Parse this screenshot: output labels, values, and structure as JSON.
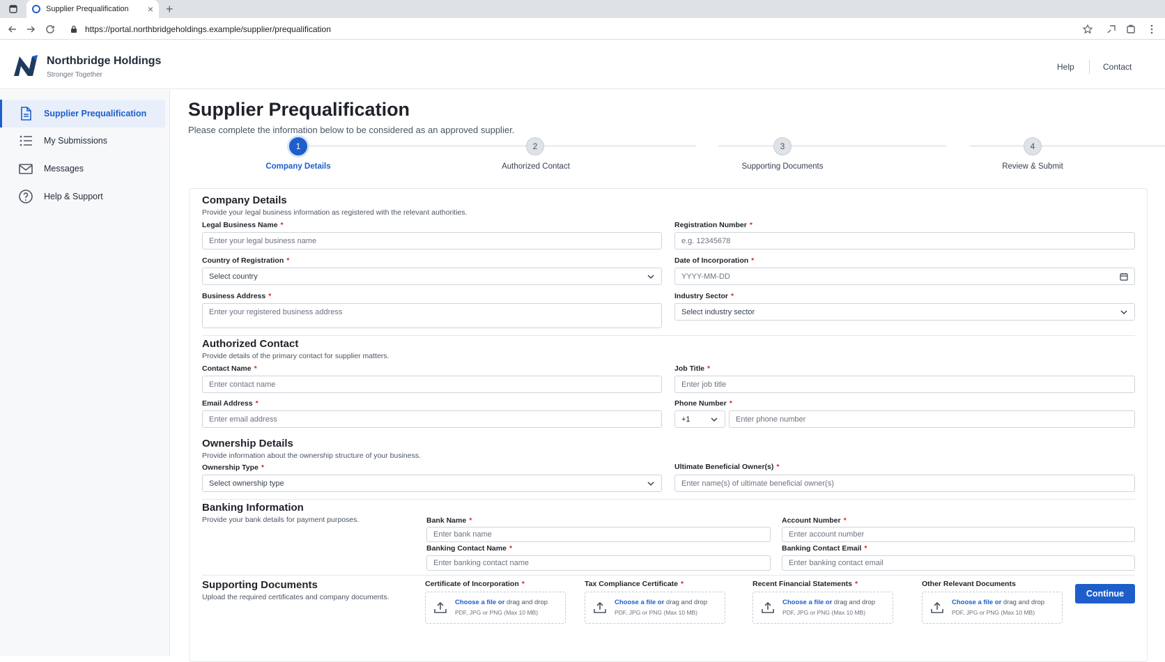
{
  "browser": {
    "tab_title": "Supplier Prequalification",
    "url": "https://portal.northbridgeholdings.example/supplier/prequalification"
  },
  "header": {
    "brand_name": "Northbridge Holdings",
    "tagline": "Stronger Together",
    "links": [
      "Help",
      "Contact"
    ]
  },
  "sidebar": {
    "items": [
      {
        "label": "Supplier Prequalification",
        "icon": "document-icon",
        "active": true
      },
      {
        "label": "My Submissions",
        "icon": "list-icon",
        "active": false
      },
      {
        "label": "Messages",
        "icon": "mail-icon",
        "active": false
      },
      {
        "label": "Help & Support",
        "icon": "help-circle-icon",
        "active": false
      }
    ]
  },
  "page": {
    "title": "Supplier Prequalification",
    "subtitle": "Please complete the information below to be considered as an approved supplier."
  },
  "stepper": {
    "steps": [
      {
        "number": "1",
        "label": "Company Details",
        "active": true
      },
      {
        "number": "2",
        "label": "Authorized Contact",
        "active": false
      },
      {
        "number": "3",
        "label": "Supporting Documents",
        "active": false
      },
      {
        "number": "4",
        "label": "Review & Submit",
        "active": false
      }
    ]
  },
  "required_marker": "*",
  "company": {
    "title": "Company Details",
    "desc": "Provide your legal business information as registered with the relevant authorities.",
    "legal_name": {
      "label": "Legal Business Name",
      "placeholder": "Enter your legal business name"
    },
    "reg_number": {
      "label": "Registration Number",
      "placeholder": "e.g. 12345678"
    },
    "country": {
      "label": "Country of Registration",
      "placeholder": "Select country"
    },
    "incorporation": {
      "label": "Date of Incorporation",
      "placeholder": "YYYY-MM-DD"
    },
    "address": {
      "label": "Business Address",
      "placeholder": "Enter your registered business address"
    },
    "sector": {
      "label": "Industry Sector",
      "placeholder": "Select industry sector"
    }
  },
  "contact": {
    "title": "Authorized Contact",
    "desc": "Provide details of the primary contact for supplier matters.",
    "name": {
      "label": "Contact Name",
      "placeholder": "Enter contact name"
    },
    "job": {
      "label": "Job Title",
      "placeholder": "Enter job title"
    },
    "email": {
      "label": "Email Address",
      "placeholder": "Enter email address"
    },
    "phone": {
      "label": "Phone Number",
      "code": "+1",
      "placeholder": "Enter phone number"
    }
  },
  "ownership": {
    "title": "Ownership Details",
    "desc": "Provide information about the ownership structure of your business.",
    "type": {
      "label": "Ownership Type",
      "placeholder": "Select ownership type"
    },
    "ubo": {
      "label": "Ultimate Beneficial Owner(s)",
      "placeholder": "Enter name(s) of ultimate beneficial owner(s)"
    }
  },
  "banking": {
    "title": "Banking Information",
    "desc": "Provide your bank details for payment purposes.",
    "bank": {
      "label": "Bank Name",
      "placeholder": "Enter bank name"
    },
    "account": {
      "label": "Account Number",
      "placeholder": "Enter account number"
    },
    "contact_name": {
      "label": "Banking Contact Name",
      "placeholder": "Enter banking contact name"
    },
    "contact_email": {
      "label": "Banking Contact Email",
      "placeholder": "Enter banking contact email"
    }
  },
  "documents": {
    "title": "Supporting Documents",
    "desc": "Upload the required certificates and company documents.",
    "choose": "Choose a file or",
    "drag": "drag and drop",
    "hint": "PDF, JPG or PNG (Max 10 MB)",
    "items": [
      {
        "label": "Certificate of Incorporation",
        "required": true
      },
      {
        "label": "Tax Compliance Certificate",
        "required": true
      },
      {
        "label": "Recent Financial Statements",
        "required": true
      },
      {
        "label": "Other Relevant Documents",
        "required": false
      }
    ]
  },
  "actions": {
    "continue": "Continue"
  },
  "colors": {
    "accent": "#1d5ecb",
    "required": "#dc2626"
  }
}
